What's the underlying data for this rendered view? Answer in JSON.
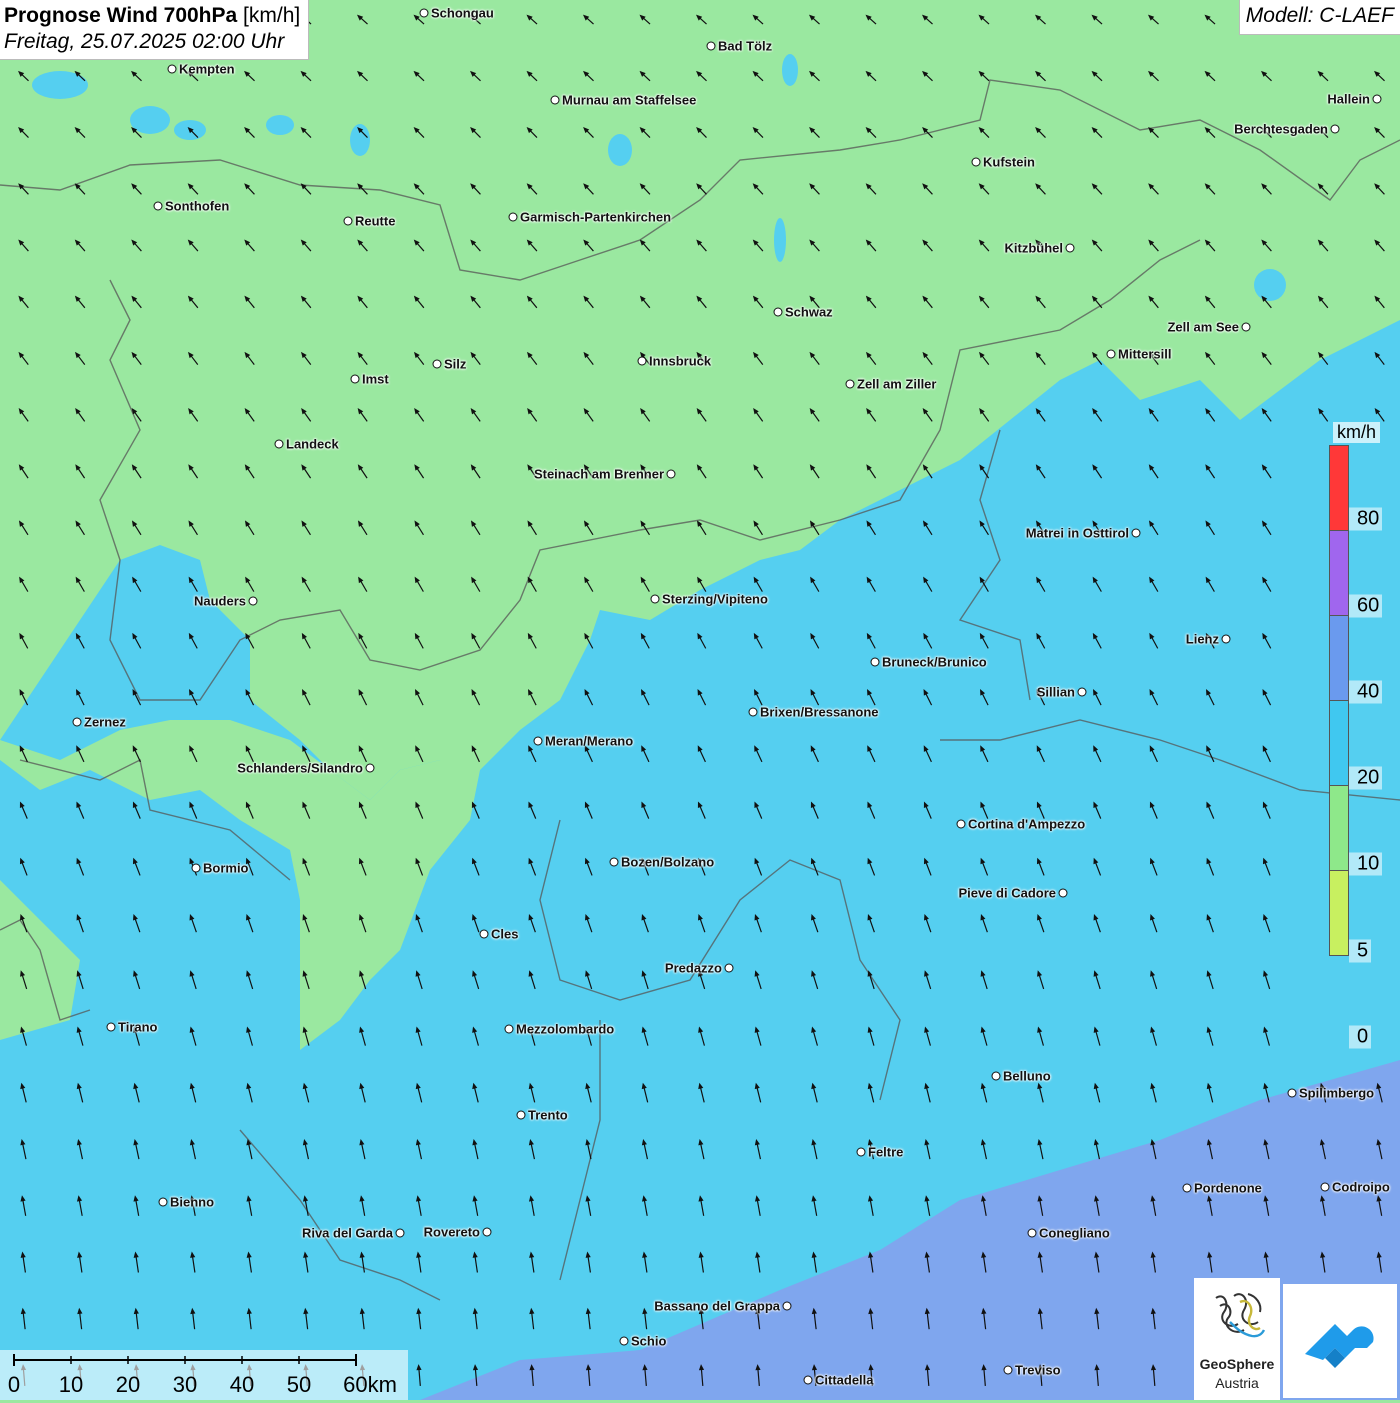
{
  "header": {
    "title_bold": "Prognose Wind 700hPa",
    "title_unit": "[km/h]",
    "date": "Freitag, 25.07.2025 02:00 Uhr",
    "model": "Modell: C-LAEF"
  },
  "colors": {
    "band_0": "#ffff66",
    "band_5": "#c8f060",
    "band_10": "#9ae8a0",
    "band_20": "#55cff0",
    "band_40": "#7fa6ee",
    "band_60": "#a87ae8",
    "band_80": "#ff3838",
    "border": "#555555",
    "arrow": "#111111"
  },
  "legend": {
    "unit": "km/h",
    "ticks": [
      "80",
      "60",
      "40",
      "20",
      "10",
      "5",
      "0"
    ]
  },
  "scalebar": {
    "labels": [
      "0",
      "10",
      "20",
      "30",
      "40",
      "50",
      "60km"
    ]
  },
  "logo": {
    "name_line1": "GeoSphere",
    "name_line2": "Austria"
  },
  "cities": [
    {
      "name": "Schongau"
    },
    {
      "name": "Bad Tölz"
    },
    {
      "name": "Kempten"
    },
    {
      "name": "Murnau am Staffelsee"
    },
    {
      "name": "Hallein"
    },
    {
      "name": "Berchtesgaden"
    },
    {
      "name": "Kufstein"
    },
    {
      "name": "Sonthofen"
    },
    {
      "name": "Reutte"
    },
    {
      "name": "Garmisch-Partenkirchen"
    },
    {
      "name": "Kitzbühel"
    },
    {
      "name": "Schwaz"
    },
    {
      "name": "Zell am See"
    },
    {
      "name": "Mittersill"
    },
    {
      "name": "Silz"
    },
    {
      "name": "Innsbruck"
    },
    {
      "name": "Imst"
    },
    {
      "name": "Zell am Ziller"
    },
    {
      "name": "Landeck"
    },
    {
      "name": "Steinach am Brenner"
    },
    {
      "name": "Matrei in Osttirol"
    },
    {
      "name": "Nauders"
    },
    {
      "name": "Sterzing/Vipiteno"
    },
    {
      "name": "Lienz"
    },
    {
      "name": "Bruneck/Brunico"
    },
    {
      "name": "Sillian"
    },
    {
      "name": "Brixen/Bressanone"
    },
    {
      "name": "Zernez"
    },
    {
      "name": "Meran/Merano"
    },
    {
      "name": "Schlanders/Silandro"
    },
    {
      "name": "Cortina d'Ampezzo"
    },
    {
      "name": "Bozen/Bolzano"
    },
    {
      "name": "Bormio"
    },
    {
      "name": "Pieve di Cadore"
    },
    {
      "name": "Cles"
    },
    {
      "name": "Predazzo"
    },
    {
      "name": "Tirano"
    },
    {
      "name": "Mezzolombardo"
    },
    {
      "name": "Belluno"
    },
    {
      "name": "Spilimbergo"
    },
    {
      "name": "Trento"
    },
    {
      "name": "Feltre"
    },
    {
      "name": "Pordenone"
    },
    {
      "name": "Codroipo"
    },
    {
      "name": "Bienno"
    },
    {
      "name": "Riva del Garda"
    },
    {
      "name": "Rovereto"
    },
    {
      "name": "Conegliano"
    },
    {
      "name": "Bassano del Grappa"
    },
    {
      "name": "Schio"
    },
    {
      "name": "Treviso"
    },
    {
      "name": "Cittadella"
    }
  ]
}
